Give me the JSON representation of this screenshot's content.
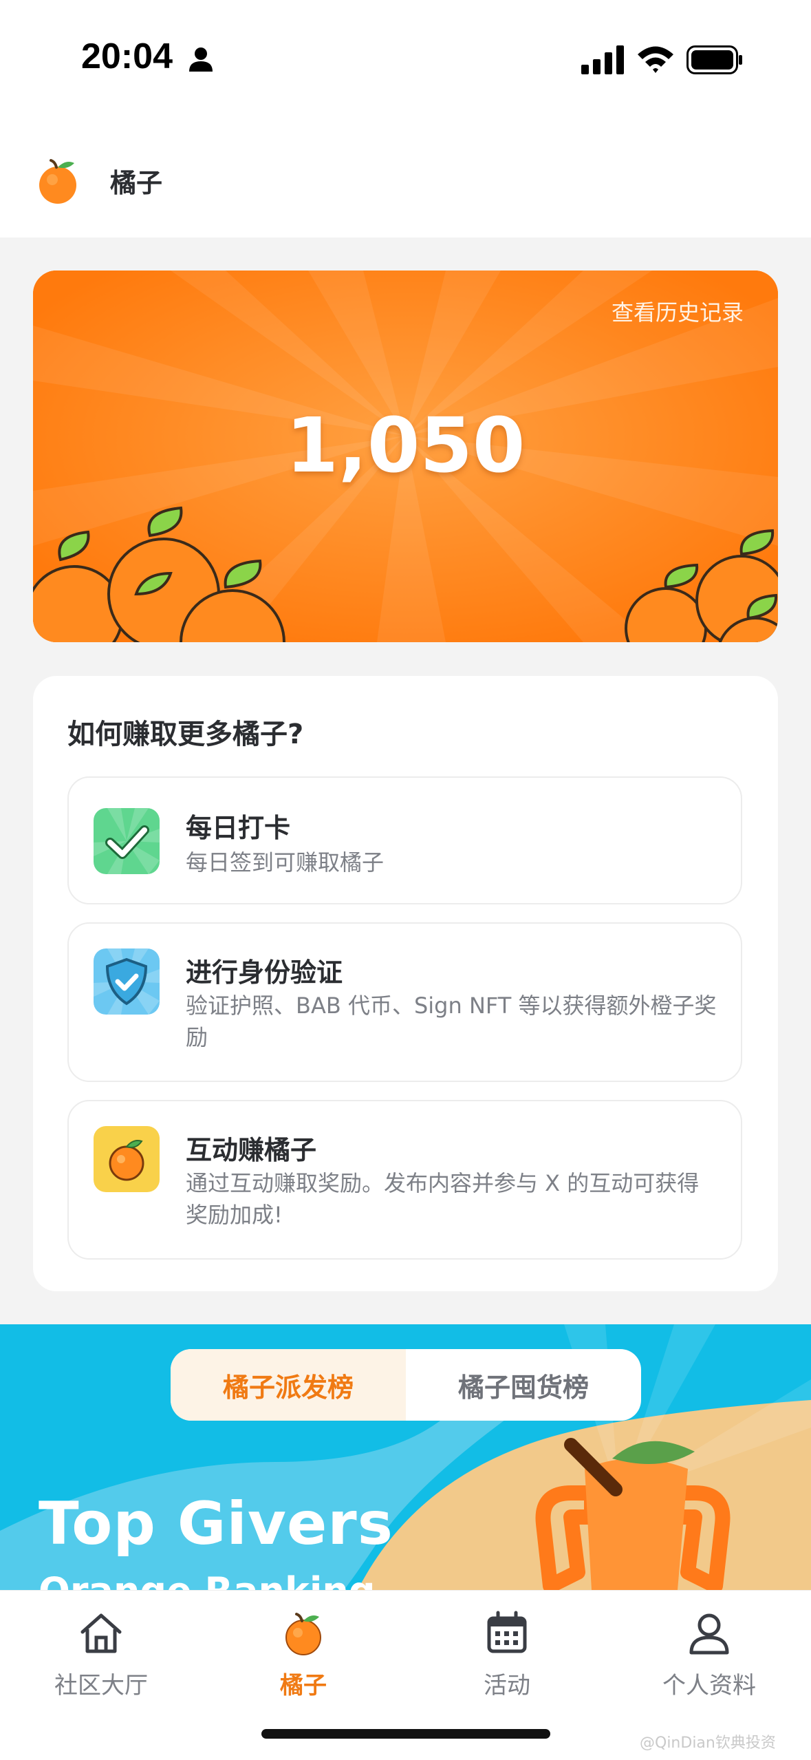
{
  "status_bar": {
    "time": "20:04"
  },
  "header": {
    "title": "橘子"
  },
  "balance": {
    "history_link": "查看历史记录",
    "value": "1,050"
  },
  "earn": {
    "title": "如何赚取更多橘子?",
    "tasks": [
      {
        "title": "每日打卡",
        "desc": "每日签到可赚取橘子",
        "icon": "checkmark-icon",
        "color": "#5fd68f"
      },
      {
        "title": "进行身份验证",
        "desc": "验证护照、BAB 代币、Sign NFT 等以获得额外橙子奖励",
        "icon": "shield-check-icon",
        "color": "#6cc8f2"
      },
      {
        "title": "互动赚橘子",
        "desc": "通过互动赚取奖励。发布内容并参与 X 的互动可获得奖励加成!",
        "icon": "orange-icon",
        "color": "#f9d14a"
      }
    ]
  },
  "ranking": {
    "tabs": [
      "橘子派发榜",
      "橘子囤货榜"
    ],
    "active_tab": 0,
    "banner_title": "Top Givers",
    "banner_subtitle": "Orange Ranking"
  },
  "nav": {
    "items": [
      {
        "label": "社区大厅",
        "icon": "home-icon"
      },
      {
        "label": "橘子",
        "icon": "orange-icon"
      },
      {
        "label": "活动",
        "icon": "calendar-icon"
      },
      {
        "label": "个人资料",
        "icon": "profile-icon"
      }
    ],
    "active": 1
  },
  "watermark": "@QinDian钦典投资",
  "colors": {
    "accent": "#f07a13",
    "card_orange": "#ff7a0d",
    "banner_blue": "#12bde6"
  }
}
